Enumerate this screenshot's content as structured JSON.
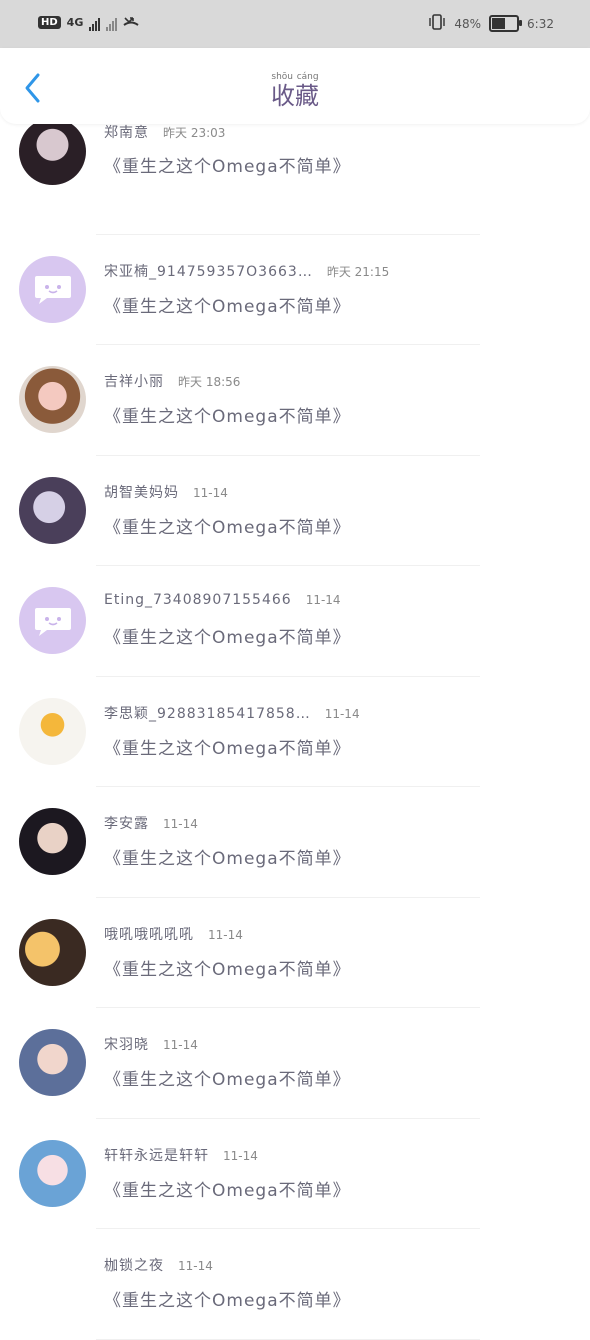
{
  "status_bar": {
    "hd": "HD",
    "network": "4G",
    "battery_percent": "48%",
    "time": "6:32",
    "icons": [
      "hd-icon",
      "signal-icon",
      "no-signal-icon",
      "missed-call-icon",
      "vibrate-icon",
      "battery-icon"
    ]
  },
  "header": {
    "title": "收藏",
    "title_pinyin": "shōu cáng",
    "back_icon": "chevron-left-icon",
    "accent": "#2f96e8"
  },
  "items": [
    {
      "name": "郑南意",
      "time": "昨天 23:03",
      "content": "《重生之这个Omega不简单》"
    },
    {
      "name": "宋亚楠_914759357O3663…",
      "time": "昨天 21:15",
      "content": "《重生之这个Omega不简单》"
    },
    {
      "name": "吉祥小丽",
      "time": "昨天 18:56",
      "content": "《重生之这个Omega不简单》"
    },
    {
      "name": "胡智美妈妈",
      "time": "11-14",
      "content": "《重生之这个Omega不简单》"
    },
    {
      "name": "Eting_73408907155466",
      "time": "11-14",
      "content": "《重生之这个Omega不简单》"
    },
    {
      "name": "李思颖_92883185417858…",
      "time": "11-14",
      "content": "《重生之这个Omega不简单》"
    },
    {
      "name": "李安露",
      "time": "11-14",
      "content": "《重生之这个Omega不简单》"
    },
    {
      "name": "哦吼哦吼吼吼",
      "time": "11-14",
      "content": "《重生之这个Omega不简单》"
    },
    {
      "name": "宋羽晓",
      "time": "11-14",
      "content": "《重生之这个Omega不简单》"
    },
    {
      "name": "轩轩永远是轩轩",
      "time": "11-14",
      "content": "《重生之这个Omega不简单》"
    },
    {
      "name": "枷锁之夜",
      "time": "11-14",
      "content": "《重生之这个Omega不简单》"
    }
  ]
}
